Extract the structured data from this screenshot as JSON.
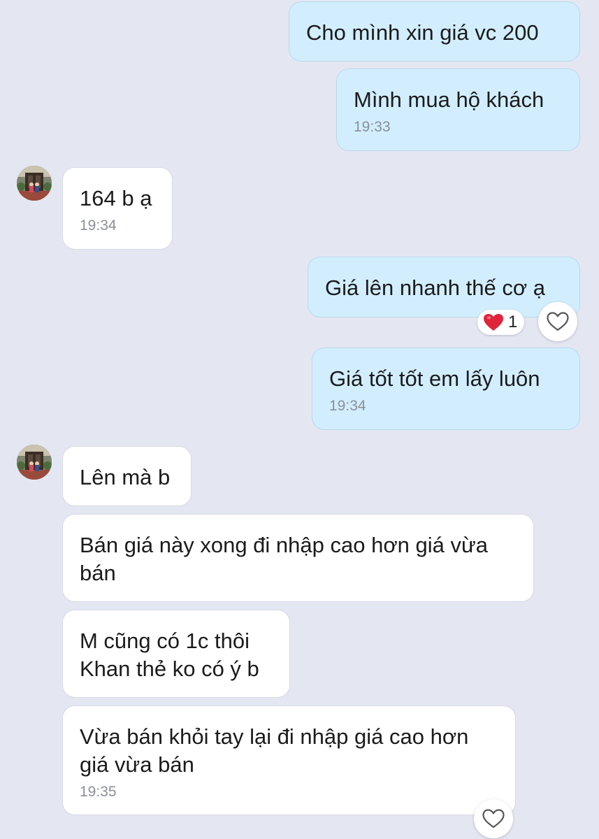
{
  "messages": [
    {
      "id": "m1",
      "direction": "out",
      "text": "Cho mình xin giá vc 200",
      "time": ""
    },
    {
      "id": "m2",
      "direction": "out",
      "text": "Mình mua hộ khách",
      "time": "19:33"
    },
    {
      "id": "m3",
      "direction": "in",
      "text": "164 b ạ",
      "time": "19:34"
    },
    {
      "id": "m4",
      "direction": "out",
      "text": "Giá lên nhanh thế cơ ạ",
      "time": "",
      "reaction": {
        "icon": "heart-icon",
        "count": "1"
      }
    },
    {
      "id": "m5",
      "direction": "out",
      "text": "Giá tốt tốt em lấy luôn",
      "time": "19:34"
    },
    {
      "id": "m6",
      "direction": "in",
      "text": "Lên mà b",
      "time": ""
    },
    {
      "id": "m7",
      "direction": "in",
      "text": [
        "Bán giá này xong đi nhập cao hơn giá vừa",
        "bán"
      ],
      "time": ""
    },
    {
      "id": "m8",
      "direction": "in",
      "text": [
        "M cũng có 1c thôi",
        "Khan thẻ ko có ý b"
      ],
      "time": ""
    },
    {
      "id": "m9",
      "direction": "in",
      "text": [
        "Vừa bán khỏi tay lại đi nhập giá cao hơn",
        "giá vừa bán"
      ],
      "time": "19:35"
    }
  ],
  "colors": {
    "background": "#e4e7f2",
    "outgoing_bubble": "#d2eefe",
    "incoming_bubble": "#ffffff",
    "timestamp": "#8a8f98",
    "heart": "#e0243a"
  }
}
